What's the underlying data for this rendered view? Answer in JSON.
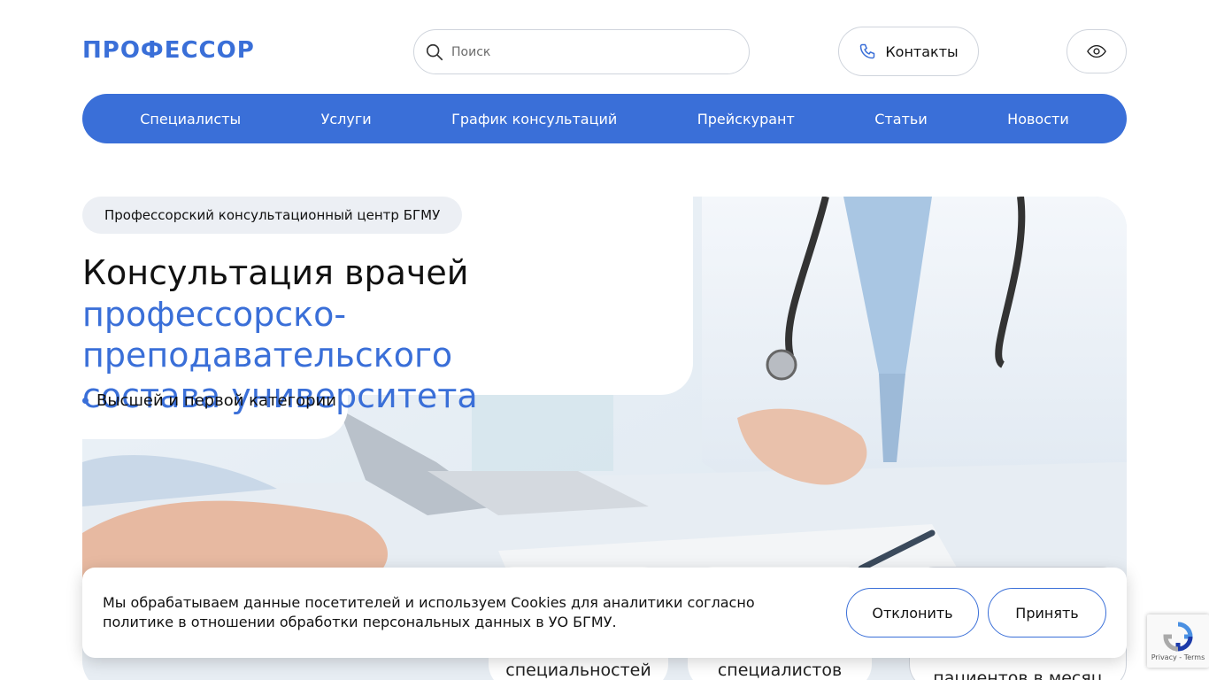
{
  "header": {
    "logo": "ПРОФЕССОР",
    "search_placeholder": "Поиск",
    "contacts_label": "Контакты"
  },
  "nav": {
    "items": [
      "Специалисты",
      "Услуги",
      "График консультаций",
      "Прейскурант",
      "Статьи",
      "Новости"
    ]
  },
  "hero": {
    "tag": "Профессорский консультационный центр БГМУ",
    "title_line1": "Консультация врачей",
    "title_line2": "профессорско-преподавательского",
    "title_line3": "состава университета",
    "bullet": "Высшей и первой категории"
  },
  "stats": {
    "card1": "специальностей",
    "card2": "специалистов",
    "card3": "пациентов в месяц"
  },
  "cookie": {
    "text": "Мы обрабатываем данные посетителей и используем Cookies для аналитики согласно политике в отношении обработки персональных данных в УО БГМУ.",
    "decline_label": "Отклонить",
    "accept_label": "Принять"
  },
  "recaptcha": {
    "links": "Privacy - Terms"
  },
  "colors": {
    "accent": "#3a6fd8",
    "tag_bg": "#eceff4",
    "border": "#cfd4dc"
  }
}
